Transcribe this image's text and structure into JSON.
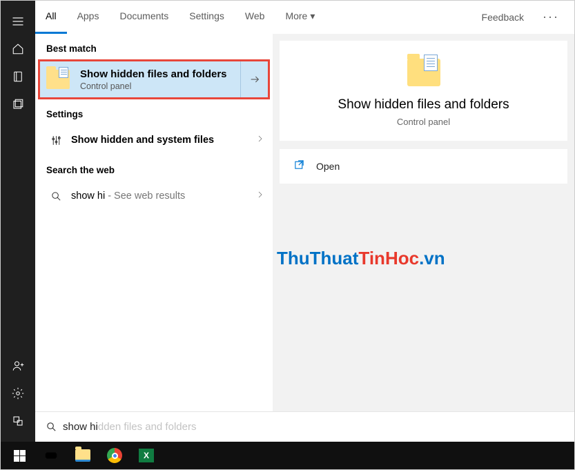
{
  "tabs": {
    "all": "All",
    "apps": "Apps",
    "documents": "Documents",
    "settings": "Settings",
    "web": "Web",
    "more": "More",
    "feedback": "Feedback"
  },
  "sections": {
    "best_match": "Best match",
    "settings": "Settings",
    "search_web": "Search the web"
  },
  "best_match": {
    "title": "Show hidden files and folders",
    "subtitle": "Control panel"
  },
  "setting_item": {
    "label": "Show hidden and system files"
  },
  "web_item": {
    "query": "show hi",
    "suffix": " - See web results"
  },
  "preview": {
    "title": "Show hidden files and folders",
    "subtitle": "Control panel",
    "open": "Open"
  },
  "search": {
    "value": "show hi",
    "ghost": "dden files and folders"
  },
  "watermark": {
    "a": "ThuThuat",
    "b": "TinHoc",
    "c": ".vn"
  }
}
